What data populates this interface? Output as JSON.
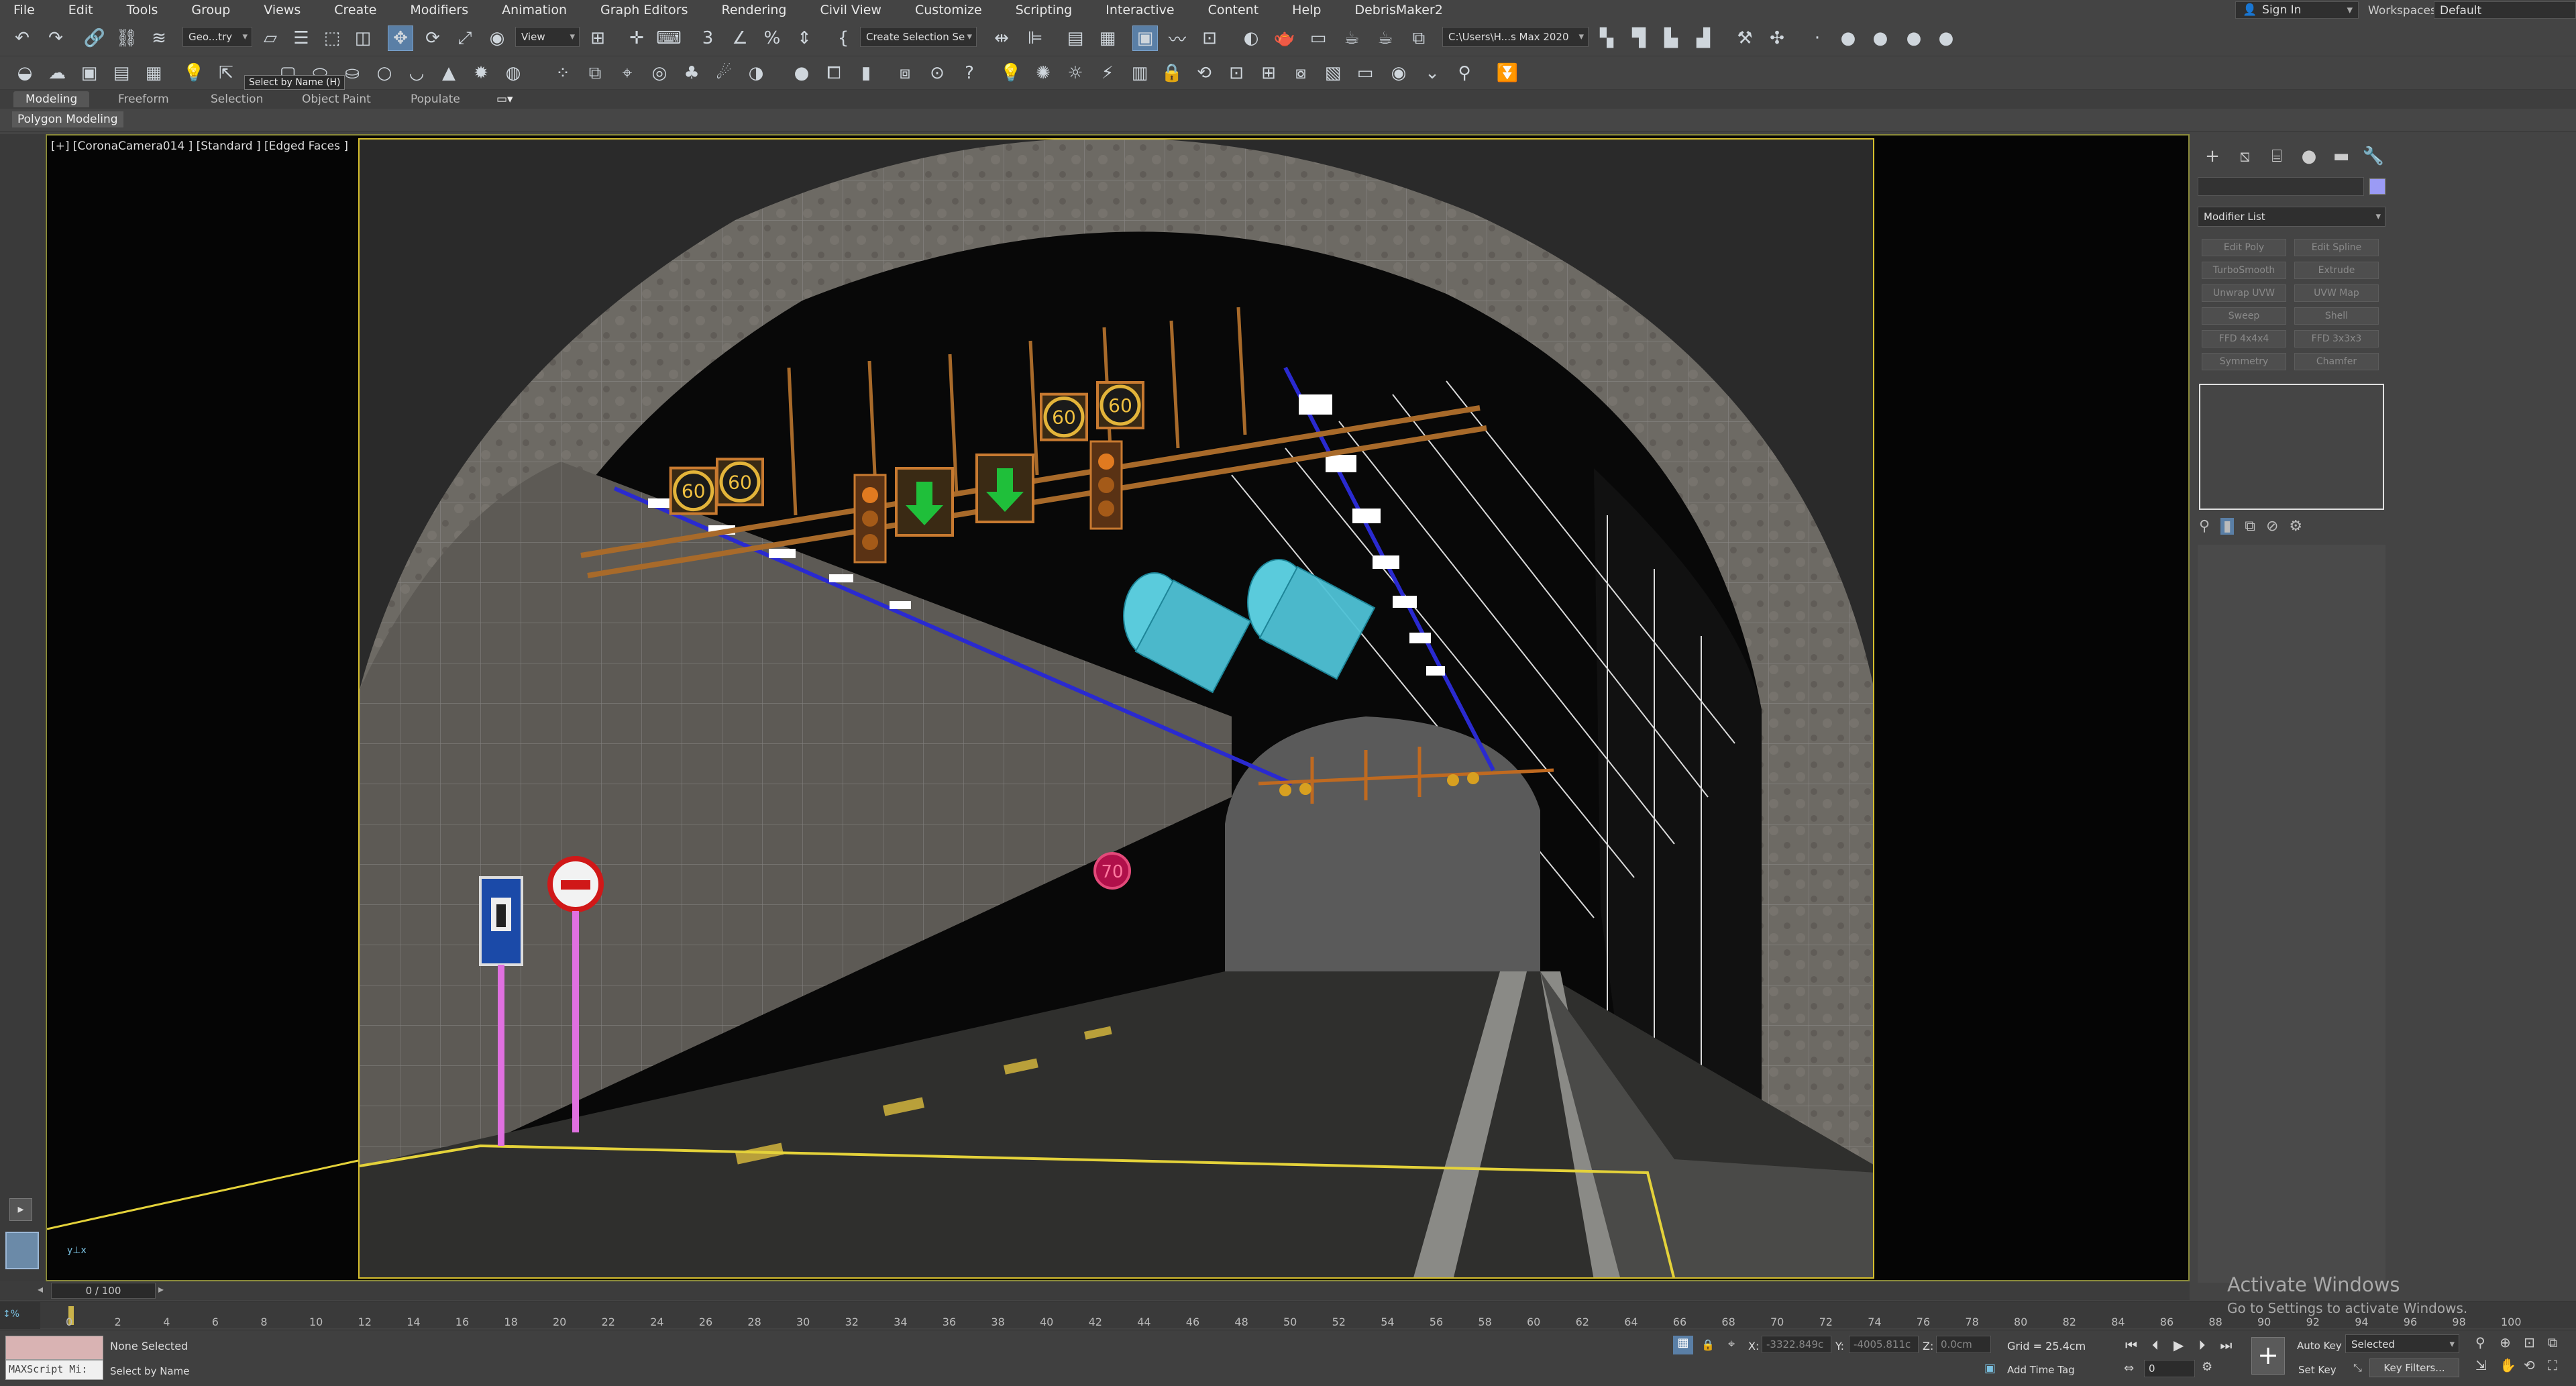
{
  "menu": [
    "File",
    "Edit",
    "Tools",
    "Group",
    "Views",
    "Create",
    "Modifiers",
    "Animation",
    "Graph Editors",
    "Rendering",
    "Civil View",
    "Customize",
    "Scripting",
    "Interactive",
    "Content",
    "Help",
    "DebrisMaker2"
  ],
  "account": {
    "sign_in": "Sign In",
    "workspaces_label": "Workspaces:",
    "workspace": "Default"
  },
  "toolbar": {
    "selection_filter": "Geo...try",
    "ref_coord": "View",
    "named_selection": "Create Selection Se",
    "project_path": "C:\\Users\\H...s Max 2020",
    "tooltip": "Select by Name  (H)"
  },
  "ribbon": {
    "tabs": [
      "Modeling",
      "Freeform",
      "Selection",
      "Object Paint",
      "Populate"
    ],
    "active": "Modeling",
    "sub_label": "Polygon Modeling"
  },
  "viewport": {
    "label": "[+] [CoronaCamera014 ] [Standard ] [Edged Faces ]"
  },
  "command_panel": {
    "modifier_list": "Modifier List",
    "buttons": [
      "Edit Poly",
      "Edit Spline",
      "TurboSmooth",
      "Extrude",
      "Unwrap UVW",
      "UVW Map",
      "Sweep",
      "Shell",
      "FFD 4x4x4",
      "FFD 3x3x3",
      "Symmetry",
      "Chamfer"
    ],
    "swatch_color": "#9b9bf5"
  },
  "timeline": {
    "position": "0 / 100",
    "ticks": [
      "0",
      "2",
      "4",
      "6",
      "8",
      "10",
      "12",
      "14",
      "16",
      "18",
      "20",
      "22",
      "24",
      "26",
      "28",
      "30",
      "32",
      "34",
      "36",
      "38",
      "40",
      "42",
      "44",
      "46",
      "48",
      "50",
      "52",
      "54",
      "56",
      "58",
      "60",
      "62",
      "64",
      "66",
      "68",
      "70",
      "72",
      "74",
      "76",
      "78",
      "80",
      "82",
      "84",
      "86",
      "88",
      "90",
      "92",
      "94",
      "96",
      "98",
      "100"
    ]
  },
  "status": {
    "maxscript": "MAXScript Mi:",
    "selected": "None Selected",
    "prompt": "Select by Name",
    "x_label": "X:",
    "x": "-3322.849c",
    "y_label": "Y:",
    "y": "-4005.811c",
    "z_label": "Z:",
    "z": "0.0cm",
    "grid": "Grid = 25.4cm",
    "add_time_tag": "Add Time Tag",
    "auto_key": "Auto Key",
    "set_key": "Set Key",
    "key_mode": "Selected",
    "key_filters": "Key Filters...",
    "frame": "0"
  },
  "watermark": {
    "line1": "Activate Windows",
    "line2": "Go to Settings to activate Windows."
  },
  "scene": {
    "speed_signs": [
      "60",
      "60",
      "60",
      "60"
    ],
    "far_sign": "70"
  }
}
